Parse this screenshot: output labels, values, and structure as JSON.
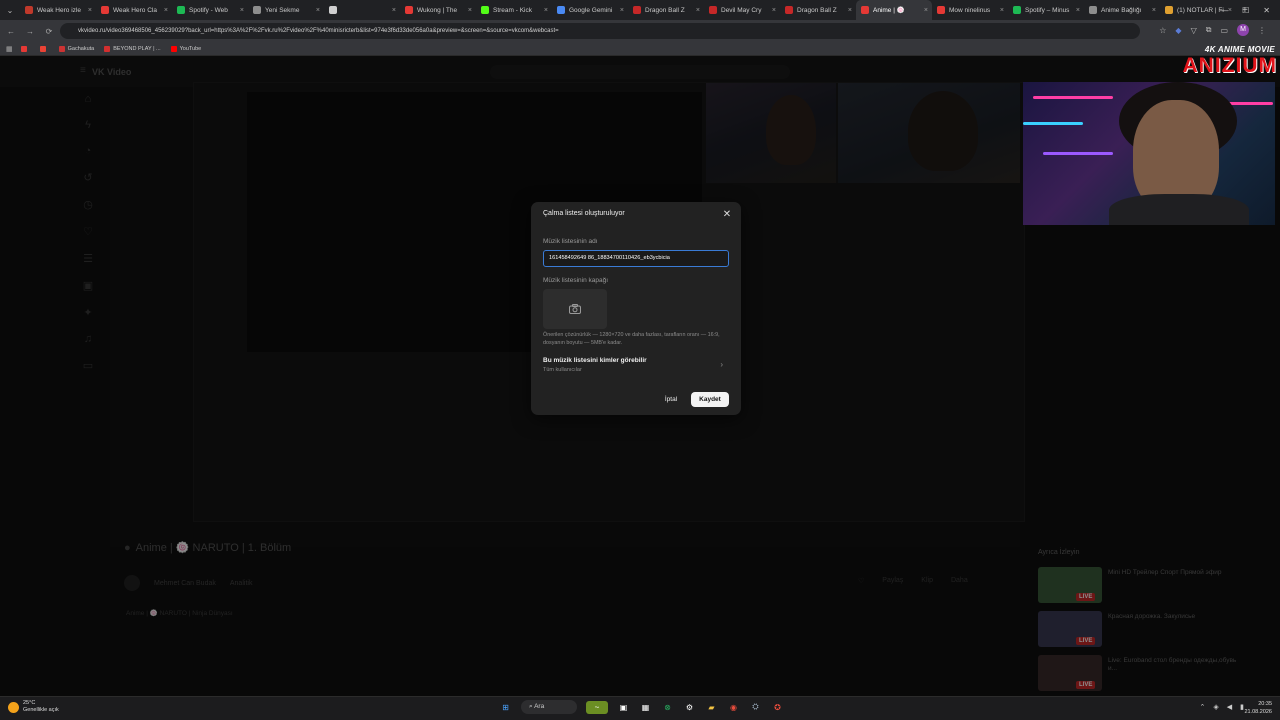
{
  "tabs": [
    {
      "label": "Weak Hero izle",
      "color": "#c0392b"
    },
    {
      "label": "Weak Hero Cla",
      "color": "#e53935"
    },
    {
      "label": "Spotify - Web",
      "color": "#1db954"
    },
    {
      "label": "Yeni Sekme",
      "color": "#8e8e8e"
    },
    {
      "label": "",
      "color": "#cfcfcf"
    },
    {
      "label": "Wukong | The",
      "color": "#e53935"
    },
    {
      "label": "Stream - Kick",
      "color": "#53fc18"
    },
    {
      "label": "Google Gemini",
      "color": "#4a8af4"
    },
    {
      "label": "Dragon Ball Z",
      "color": "#c62828"
    },
    {
      "label": "Devil May Cry",
      "color": "#c62828"
    },
    {
      "label": "Dragon Ball Z",
      "color": "#c62828"
    },
    {
      "label": "Anime | 🍥",
      "color": "#e53935",
      "active": true
    },
    {
      "label": "Mow ninelinus",
      "color": "#e53935"
    },
    {
      "label": "Spotify – Minus",
      "color": "#1db954"
    },
    {
      "label": "Anime Bağlığı",
      "color": "#8e8e8e"
    },
    {
      "label": "(1) NOTLAR | Fi",
      "color": "#e0a030"
    }
  ],
  "address": {
    "url": "vkvideo.ru/video369468506_456239029?back_url=https%3A%2F%2Fvk.ru%2Fvideo%2F%40minisricterb&list=974e3f6d33de056a0a&preview=&screen=&source=vkcom&webcast="
  },
  "bookmarks": [
    {
      "label": "",
      "color": "#e53935"
    },
    {
      "label": "",
      "color": "#ea4335"
    },
    {
      "label": "Gachakuta",
      "color": "#cc3333"
    },
    {
      "label": "BEYOND PLAY | ...",
      "color": "#d32f2f"
    },
    {
      "label": "YouTube",
      "color": "#ff0000"
    }
  ],
  "vk": {
    "logo": "VK Video",
    "title": "Anime | 🍥 NARUTO | 1. Bölüm",
    "subtitle": "",
    "author": "Mehmet Can Budak",
    "analytics": "Analitik",
    "tag": "Anime | 🍥 NARUTO | Ninja Dünyası",
    "actions": [
      "Paylaş",
      "Klip",
      "Daha"
    ],
    "also_watch": "Ayrıca İzleyin",
    "recs": [
      {
        "title": "Mini HD Трейлер Спорт Прямой эфир",
        "live": "LIVE",
        "thumb": "#3a5a3a"
      },
      {
        "title": "Красная дорожка. Закулисье",
        "live": "LIVE",
        "thumb": "#3a3a52"
      },
      {
        "title": "Live: Euroband стол бренды одежды,обувь и...",
        "live": "LIVE",
        "thumb": "#3a2a2a"
      }
    ]
  },
  "overlay_logo": {
    "top": "4K ANIME MOVIE",
    "main": "ANIZIUM"
  },
  "modal": {
    "title": "Çalma listesi oluşturuluyor",
    "name_label": "Müzik listesinin adı",
    "name_value": "161458492649 86_18834700110426_eb3ycbicia",
    "cover_label": "Müzik listesinin kapağı",
    "hint": "Önerilen çözünürlük — 1280×720 ve daha fazlası, tarafların oranı — 16:9, dosyanın boyutu — 5MB'e kadar.",
    "visibility_title": "Bu müzik listesini kimler görebilir",
    "visibility_value": "Tüm kullanıcılar",
    "cancel": "İptal",
    "save": "Kaydet"
  },
  "taskbar": {
    "temp": "25°C",
    "weather": "Genellikle açık",
    "search": "Ara",
    "time": "20:35",
    "date": "21.08.2026"
  }
}
